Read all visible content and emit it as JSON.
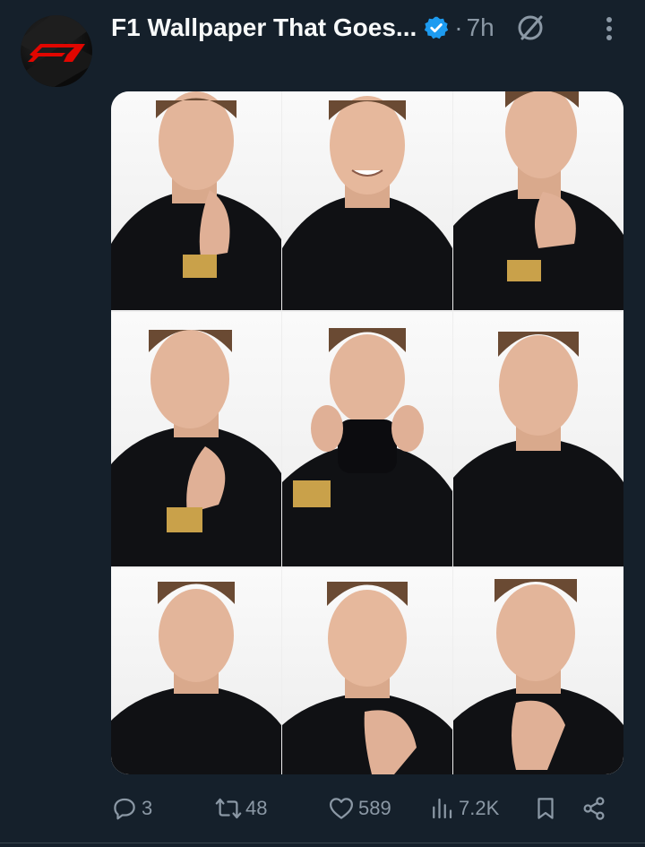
{
  "tweet": {
    "display_name": "F1 Wallpaper That Goes...",
    "separator": "·",
    "time": "7h",
    "media_alt": "Grid of nine portrait photos",
    "icons": {
      "avatar": "f1-logo-avatar",
      "verified": "verified-badge-icon",
      "grok": "no-sign-icon",
      "more": "more-vertical-icon"
    }
  },
  "actions": {
    "reply_count": "3",
    "retweet_count": "48",
    "like_count": "589",
    "views_count": "7.2K"
  },
  "colors": {
    "background": "#15202b",
    "text": "#f7f9f9",
    "muted": "#8b98a5",
    "verified": "#1d9bf0",
    "f1_red": "#e10600"
  }
}
